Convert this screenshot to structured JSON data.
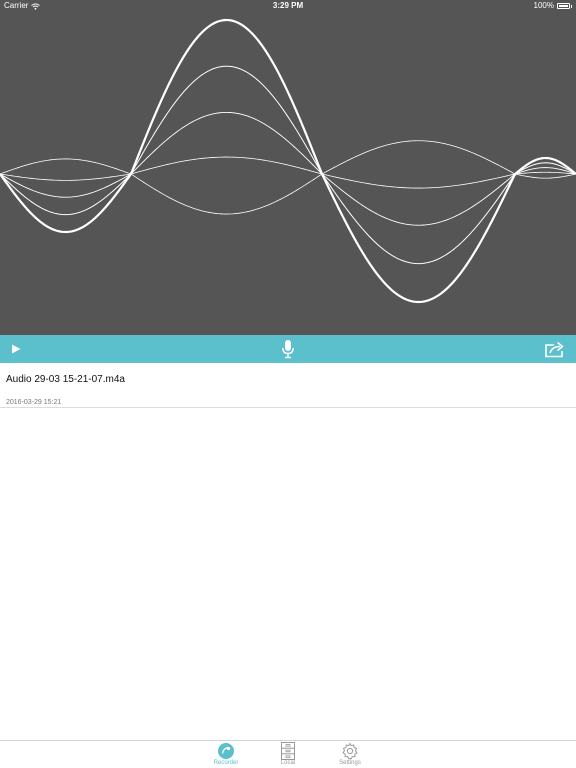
{
  "status_bar": {
    "carrier": "Carrier",
    "time": "3:29 PM",
    "battery": "100%"
  },
  "controls": {
    "play_icon": "play-icon",
    "mic_icon": "microphone-icon",
    "share_icon": "share-icon"
  },
  "recordings": [
    {
      "name": "Audio 29-03 15-21-07.m4a",
      "date": "2016-03-29 15:21"
    }
  ],
  "tabs": [
    {
      "label": "Recorder",
      "icon": "record-icon",
      "active": true
    },
    {
      "label": "Local",
      "icon": "cabinet-icon",
      "active": false
    },
    {
      "label": "Settings",
      "icon": "gear-icon",
      "active": false
    }
  ],
  "colors": {
    "accent": "#5bbfcc",
    "wave_background": "#555555",
    "wave_stroke": "#ffffff",
    "tab_active": "#5bbfcc",
    "tab_inactive": "#9a9a9a"
  }
}
